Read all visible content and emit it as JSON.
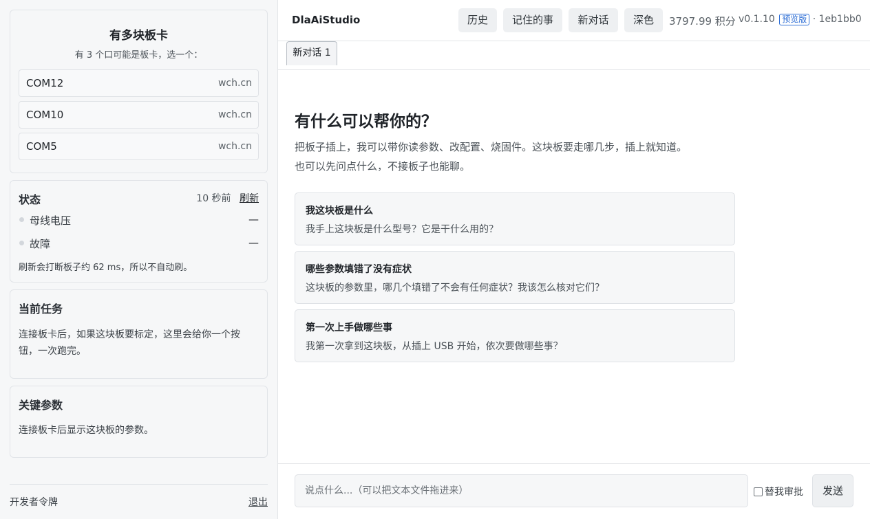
{
  "sidebar": {
    "boards": {
      "title": "有多块板卡",
      "subtitle": "有 3 个口可能是板卡，选一个：",
      "ports": [
        {
          "name": "COM12",
          "vendor": "wch.cn"
        },
        {
          "name": "COM10",
          "vendor": "wch.cn"
        },
        {
          "name": "COM5",
          "vendor": "wch.cn"
        }
      ]
    },
    "status": {
      "title": "状态",
      "ago": "10 秒前",
      "refresh_label": "刷新",
      "rows": [
        {
          "label": "母线电压",
          "value": "—"
        },
        {
          "label": "故障",
          "value": "—"
        }
      ],
      "note": "刷新会打断板子约 62 ms，所以不自动刷。"
    },
    "task": {
      "title": "当前任务",
      "body": "连接板卡后，如果这块板要标定，这里会给你一个按钮，一次跑完。"
    },
    "params": {
      "title": "关键参数",
      "body": "连接板卡后显示这块板的参数。"
    },
    "footer": {
      "dev_token": "开发者令牌",
      "logout": "退出"
    }
  },
  "header": {
    "brand": "DlaAiStudio",
    "buttons": {
      "history": "历史",
      "memory": "记住的事",
      "new_chat": "新对话",
      "theme": "深色"
    },
    "points": "3797.99 积分",
    "version": "v0.1.10",
    "badge": "预览版",
    "build": "· 1eb1bb0"
  },
  "tabs": [
    {
      "label": "新对话 1"
    }
  ],
  "chat": {
    "title": "有什么可以帮你的？",
    "desc_line1": "把板子插上，我可以带你读参数、改配置、烧固件。这块板要走哪几步，插上就知道。",
    "desc_line2": "也可以先问点什么，不接板子也能聊。",
    "suggestions": [
      {
        "title": "我这块板是什么",
        "body": "我手上这块板是什么型号？它是干什么用的？"
      },
      {
        "title": "哪些参数填错了没有症状",
        "body": "这块板的参数里，哪几个填错了不会有任何症状？我该怎么核对它们？"
      },
      {
        "title": "第一次上手做哪些事",
        "body": "我第一次拿到这块板，从插上 USB 开始，依次要做哪些事？"
      }
    ]
  },
  "composer": {
    "placeholder": "说点什么...（可以把文本文件拖进来）",
    "approve_label": "替我审批",
    "send_label": "发送"
  },
  "colors": {
    "badge": "#2f6fd6",
    "sidebar_bg": "#f6f7f8"
  }
}
